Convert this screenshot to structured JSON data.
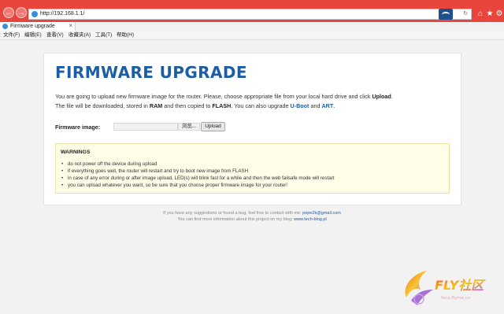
{
  "browser": {
    "url": "http://192.168.1.1/",
    "tab_title": "Firmware upgrade",
    "menu": [
      "文件(F)",
      "编辑(E)",
      "查看(V)",
      "收藏夹(A)",
      "工具(T)",
      "帮助(H)"
    ]
  },
  "page": {
    "heading": "FIRMWARE UPGRADE",
    "desc_line1_a": "You are going to upload new firmware image for the router. Please, choose appropriate file from your local hard drive and click ",
    "desc_line1_b": "Upload",
    "desc_line1_c": ".",
    "desc_line2_a": "The file will be downloaded, stored in ",
    "desc_line2_ram": "RAM",
    "desc_line2_b": " and then copied to ",
    "desc_line2_flash": "FLASH",
    "desc_line2_c": ". You can also upgrade ",
    "desc_line2_uboot": "U-Boot",
    "desc_line2_and": " and ",
    "desc_line2_art": "ART",
    "desc_line2_end": ".",
    "firmware_label": "Firmware image:",
    "browse_label": "浏览...",
    "upload_label": "Upload",
    "warnings_title": "WARNINGS",
    "warnings": [
      "do not power off the device during upload",
      "if everything goes well, the router will restart and try to boot new image from FLASH",
      "in case of any error during or after image upload, LED(s) will blink fast for a while and then the web failsafe mode will restart",
      "you can upload whatever you want, so be sure that you choose proper firmware image for your router!"
    ],
    "footer1_text": "If you have any suggestions or found a bug, feel free to contact with me: ",
    "footer1_link": "pepe2k@gmail.com",
    "footer2_text": "You can find more information about this project on my blog: ",
    "footer2_link": "www.tech-blog.pl"
  },
  "watermark": {
    "text": "FLY社区",
    "sub": "fans.flyme.cn"
  },
  "colors": {
    "chrome_red": "#e8453c",
    "heading_blue": "#1c5ea6",
    "warning_bg": "#fefde8"
  }
}
